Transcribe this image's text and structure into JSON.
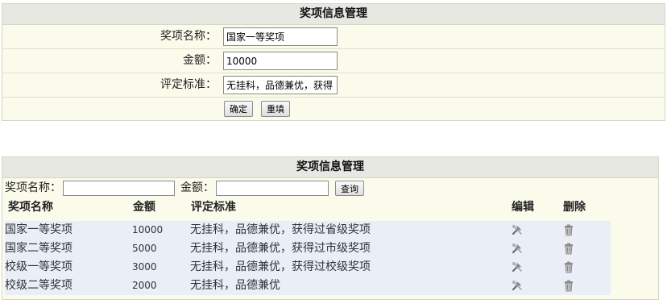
{
  "form": {
    "title": "奖项信息管理",
    "name_label": "奖项名称：",
    "name_value": "国家一等奖项",
    "amount_label": "金额：",
    "amount_value": "10000",
    "criteria_label": "评定标准：",
    "criteria_value": "无挂科，品德兼优，获得",
    "confirm_label": "确定",
    "reset_label": "重填"
  },
  "list": {
    "title": "奖项信息管理",
    "search_name_label": "奖项名称：",
    "search_amount_label": "金额：",
    "search_button_label": "查询",
    "columns": [
      "奖项名称",
      "金额",
      "评定标准",
      "编辑",
      "删除"
    ],
    "rows": [
      {
        "name": "国家一等奖项",
        "amount": "10000",
        "criteria": "无挂科，品德兼优，获得过省级奖项"
      },
      {
        "name": "国家二等奖项",
        "amount": "5000",
        "criteria": "无挂科，品德兼优，获得过市级奖项"
      },
      {
        "name": "校级一等奖项",
        "amount": "3000",
        "criteria": "无挂科，品德兼优，获得过校级奖项"
      },
      {
        "name": "校级二等奖项",
        "amount": "2000",
        "criteria": "无挂科，品德兼优"
      }
    ]
  },
  "icons": {
    "edit": "edit-tools-icon",
    "delete": "trash-can-icon"
  }
}
